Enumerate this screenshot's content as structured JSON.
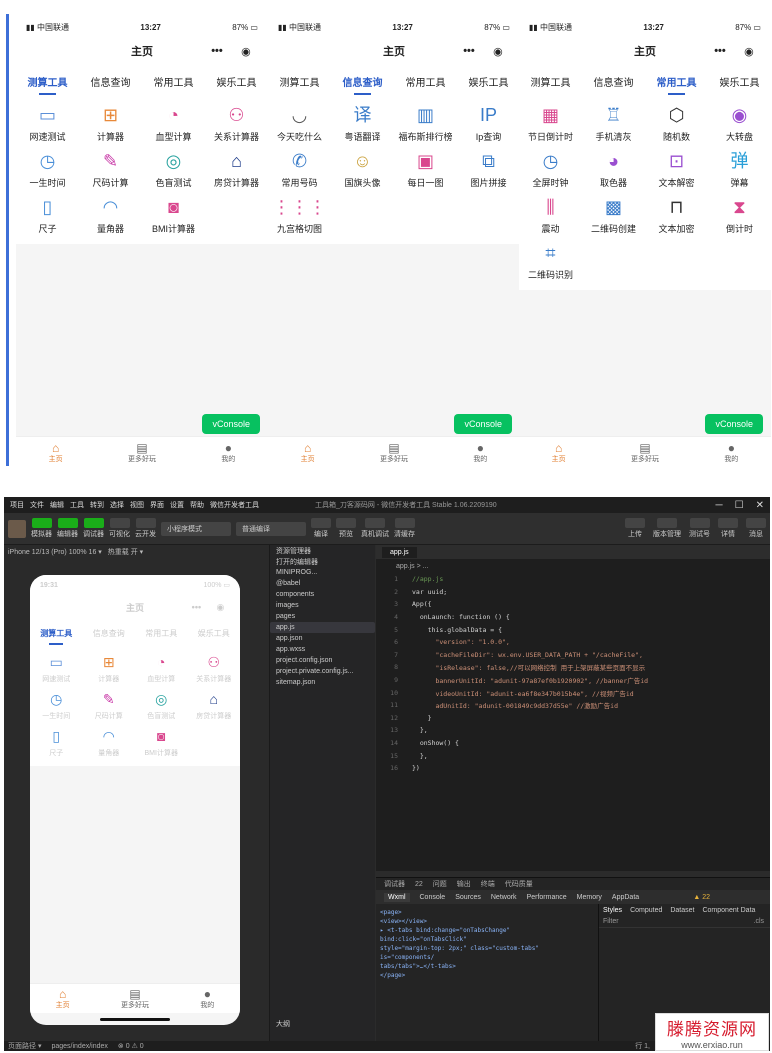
{
  "phones": [
    {
      "status": {
        "carrier": "中国联通",
        "time": "13:27",
        "battery": "87%"
      },
      "nav_title": "主页",
      "tabs": [
        "测算工具",
        "信息查询",
        "常用工具",
        "娱乐工具"
      ],
      "active_tab": 0,
      "items": [
        {
          "label": "网速测试",
          "icon": "speed-test-icon",
          "glyph": "▭",
          "color": "#5b8fd8"
        },
        {
          "label": "计算器",
          "icon": "calculator-icon",
          "glyph": "⊞",
          "color": "#e8893a"
        },
        {
          "label": "血型计算",
          "icon": "blood-type-icon",
          "glyph": "◔",
          "color": "#d9478e"
        },
        {
          "label": "关系计算器",
          "icon": "relationship-icon",
          "glyph": "⚇",
          "color": "#d9478e"
        },
        {
          "label": "一生时间",
          "icon": "clock-icon",
          "glyph": "◷",
          "color": "#4a8fd8"
        },
        {
          "label": "尺码计算",
          "icon": "ruler-pencil-icon",
          "glyph": "✎",
          "color": "#c93aa8"
        },
        {
          "label": "色盲测试",
          "icon": "target-icon",
          "glyph": "◎",
          "color": "#2aa3a0"
        },
        {
          "label": "房贷计算器",
          "icon": "house-loan-icon",
          "glyph": "⌂",
          "color": "#1f3d8a"
        },
        {
          "label": "尺子",
          "icon": "ruler-icon",
          "glyph": "▯",
          "color": "#4a8fd8"
        },
        {
          "label": "量角器",
          "icon": "protractor-icon",
          "glyph": "◠",
          "color": "#4a8fd8"
        },
        {
          "label": "BMI计算器",
          "icon": "bmi-scale-icon",
          "glyph": "◙",
          "color": "#d9478e"
        }
      ],
      "vconsole": "vConsole",
      "show_vconsole": true
    },
    {
      "status": {
        "carrier": "中国联通",
        "time": "13:27",
        "battery": "87%"
      },
      "nav_title": "主页",
      "tabs": [
        "测算工具",
        "信息查询",
        "常用工具",
        "娱乐工具"
      ],
      "active_tab": 1,
      "items": [
        {
          "label": "今天吃什么",
          "icon": "bowl-icon",
          "glyph": "◡",
          "color": "#555"
        },
        {
          "label": "粤语翻译",
          "icon": "translate-icon",
          "glyph": "译",
          "color": "#3a7cc9"
        },
        {
          "label": "福布斯排行榜",
          "icon": "buildings-icon",
          "glyph": "▥",
          "color": "#3a7cc9"
        },
        {
          "label": "Ip查询",
          "icon": "ip-icon",
          "glyph": "IP",
          "color": "#3a7cc9"
        },
        {
          "label": "常用号码",
          "icon": "phone-icon",
          "glyph": "✆",
          "color": "#3a7cc9"
        },
        {
          "label": "国旗头像",
          "icon": "flag-avatar-icon",
          "glyph": "☺",
          "color": "#c9a03a"
        },
        {
          "label": "每日一图",
          "icon": "image-icon",
          "glyph": "▣",
          "color": "#d9478e"
        },
        {
          "label": "图片拼接",
          "icon": "image-join-icon",
          "glyph": "⧉",
          "color": "#3a7cc9"
        },
        {
          "label": "九宫格切图",
          "icon": "nine-grid-icon",
          "glyph": "⋮⋮⋮",
          "color": "#d9478e"
        }
      ],
      "vconsole": "vConsole",
      "show_vconsole": true
    },
    {
      "status": {
        "carrier": "中国联通",
        "time": "13:27",
        "battery": "87%"
      },
      "nav_title": "主页",
      "tabs": [
        "测算工具",
        "信息查询",
        "常用工具",
        "娱乐工具"
      ],
      "active_tab": 2,
      "items": [
        {
          "label": "节日倒计时",
          "icon": "calendar-icon",
          "glyph": "▦",
          "color": "#d9478e"
        },
        {
          "label": "手机清灰",
          "icon": "phone-clean-icon",
          "glyph": "♖",
          "color": "#3a7cc9"
        },
        {
          "label": "随机数",
          "icon": "dice-icon",
          "glyph": "⬡",
          "color": "#333"
        },
        {
          "label": "大转盘",
          "icon": "wheel-icon",
          "glyph": "◉",
          "color": "#9a4fd0"
        },
        {
          "label": "全屏时钟",
          "icon": "clock-icon",
          "glyph": "◷",
          "color": "#3a7cc9"
        },
        {
          "label": "取色器",
          "icon": "palette-icon",
          "glyph": "◕",
          "color": "#9a4fd0"
        },
        {
          "label": "文本解密",
          "icon": "unlock-icon",
          "glyph": "⊡",
          "color": "#9a4fd0"
        },
        {
          "label": "弹幕",
          "icon": "danmaku-icon",
          "glyph": "弹",
          "color": "#2a9fd8"
        },
        {
          "label": "震动",
          "icon": "vibrate-icon",
          "glyph": "⫼",
          "color": "#d9478e"
        },
        {
          "label": "二维码创建",
          "icon": "qrcode-icon",
          "glyph": "▩",
          "color": "#3a7cc9"
        },
        {
          "label": "文本加密",
          "icon": "lock-icon",
          "glyph": "⊓",
          "color": "#333"
        },
        {
          "label": "倒计时",
          "icon": "hourglass-icon",
          "glyph": "⧗",
          "color": "#d9478e"
        },
        {
          "label": "二维码识别",
          "icon": "scan-icon",
          "glyph": "⌗",
          "color": "#3a7cc9"
        }
      ],
      "vconsole": "vConsole",
      "show_vconsole": true
    }
  ],
  "tabbar": [
    {
      "label": "主页",
      "icon": "home-icon",
      "glyph": "⌂"
    },
    {
      "label": "更多好玩",
      "icon": "more-icon",
      "glyph": "▤"
    },
    {
      "label": "我的",
      "icon": "user-icon",
      "glyph": "●"
    }
  ],
  "ide": {
    "menu": [
      "项目",
      "文件",
      "编辑",
      "工具",
      "转到",
      "选择",
      "视图",
      "界面",
      "设置",
      "帮助",
      "微信开发者工具"
    ],
    "window_title": "工具箱_刀客源码网 - 微信开发者工具 Stable 1.06.2209190",
    "toolbar_left": [
      "模拟器",
      "编辑器",
      "调试器",
      "可视化",
      "云开发"
    ],
    "mode_select": "小程序模式",
    "compile_select": "普通编译",
    "toolbar_mid": [
      "编译",
      "预览",
      "真机调试",
      "清缓存"
    ],
    "toolbar_right": [
      "上传",
      "版本管理",
      "测试号",
      "详情",
      "消息"
    ],
    "sim_device": "iPhone 12/13 (Pro) 100% 16 ▾",
    "sim_hotreload": "热重载 开 ▾",
    "sim_phone": {
      "time": "19:31",
      "battery": "100%",
      "nav_title": "主页",
      "tabs": [
        "测算工具",
        "信息查询",
        "常用工具",
        "娱乐工具"
      ],
      "items": [
        "网速测试",
        "计算器",
        "血型计算",
        "关系计算器",
        "一生时间",
        "尺码计算",
        "色盲测试",
        "房贷计算器",
        "尺子",
        "量角器",
        "BMI计算器"
      ]
    },
    "explorer_title": "资源管理器",
    "explorer_open": "打开的编辑器",
    "explorer_project": "MINIPROG...",
    "files": [
      "@babel",
      "components",
      "images",
      "pages",
      "app.js",
      "app.json",
      "app.wxss",
      "project.config.json",
      "project.private.config.js...",
      "sitemap.json"
    ],
    "selected_file": "app.js",
    "outline": "大纲",
    "editor_tab": "app.js",
    "breadcrumb": "app.js > ...",
    "code_lines": [
      "//app.js",
      "var uuid;",
      "App({",
      "  onLaunch: function () {",
      "    this.globalData = {",
      "      \"version\": \"1.0.0\",",
      "      \"cacheFileDir\": wx.env.USER_DATA_PATH + \"/cacheFile\",",
      "      \"isRelease\": false,//可以网络控制 用于上架屏蔽某些页面不显示",
      "      bannerUnitId: \"adunit-97a87ef0b1920902\", //banner广告id",
      "      videoUnitId: \"adunit-ea6f8e347b015b4e\", //视频广告id",
      "      adUnitId: \"adunit-001849c9dd37d55e\" //激励广告id",
      "    }",
      "  },",
      "  onShow() {",
      "  },",
      "})"
    ],
    "debug_tabs": [
      "调试器",
      "22",
      "问题",
      "输出",
      "终端",
      "代码质量"
    ],
    "devtools_tabs": [
      "Wxml",
      "Console",
      "Sources",
      "Network",
      "Performance",
      "Memory",
      "AppData"
    ],
    "warnings": "▲ 22",
    "wxml_lines": [
      "<page>",
      "  <view></view>",
      "▸ <t-tabs bind:change=\"onTabsChange\" bind:click=\"onTabsClick\"",
      "  style=\"margin-top: 2px;\" class=\"custom-tabs\" is=\"components/",
      "  tabs/tabs\">…</t-tabs>",
      "</page>"
    ],
    "styles_tabs": [
      "Styles",
      "Computed",
      "Dataset",
      "Component Data"
    ],
    "filter_placeholder": "Filter",
    "cls": ".cls",
    "status_path": "页面路径 ▾",
    "status_page": "pages/index/index",
    "status_errors": "⊗ 0 ⚠ 0",
    "status_right": "行 1,"
  },
  "watermark": {
    "title": "滕腾资源网",
    "url": "www.erxiao.run"
  }
}
